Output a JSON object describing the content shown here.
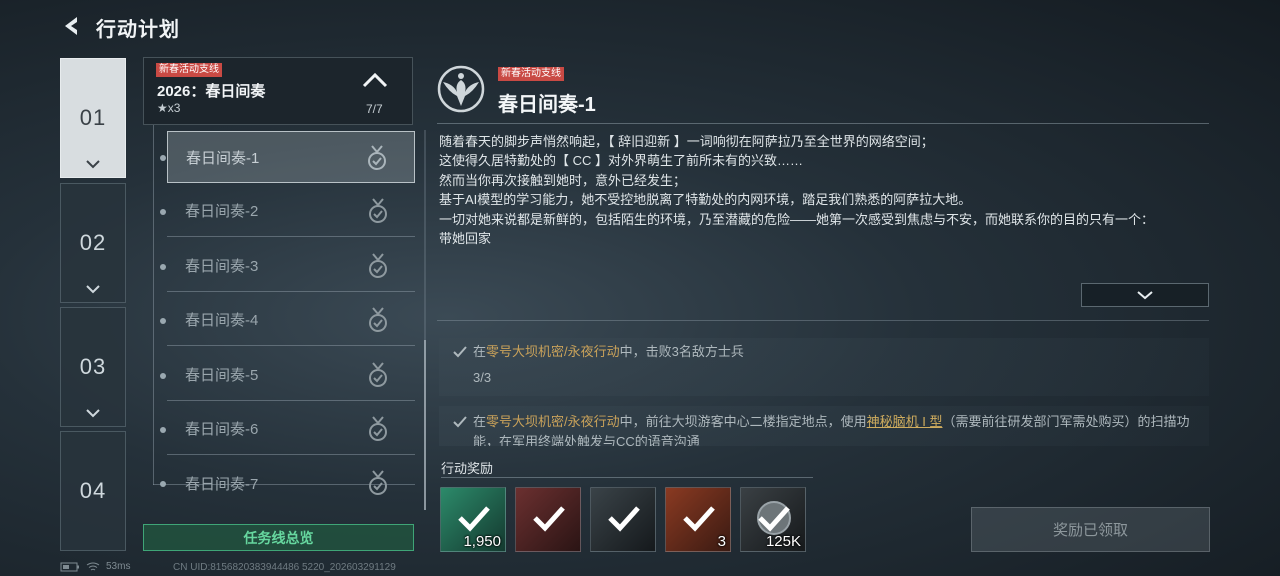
{
  "header": {
    "title": "行动计划"
  },
  "chapters": [
    {
      "num": "01",
      "active": true
    },
    {
      "num": "02",
      "active": false
    },
    {
      "num": "03",
      "active": false
    },
    {
      "num": "04",
      "active": false
    }
  ],
  "quest": {
    "tag": "新春活动支线",
    "title": "2026：春日间奏",
    "stars": "★x3",
    "progress": "7/7",
    "sub_items": [
      {
        "label": "春日间奏-1",
        "selected": true
      },
      {
        "label": "春日间奏-2",
        "selected": false
      },
      {
        "label": "春日间奏-3",
        "selected": false
      },
      {
        "label": "春日间奏-4",
        "selected": false
      },
      {
        "label": "春日间奏-5",
        "selected": false
      },
      {
        "label": "春日间奏-6",
        "selected": false
      },
      {
        "label": "春日间奏-7",
        "selected": false
      }
    ],
    "overview_button": "任务线总览"
  },
  "detail": {
    "tag": "新春活动支线",
    "title": "春日间奏-1",
    "story": [
      "随着春天的脚步声悄然响起，【 辞旧迎新 】一词响彻在阿萨拉乃至全世界的网络空间；",
      "这使得久居特勤处的【 CC 】对外界萌生了前所未有的兴致……",
      "然而当你再次接触到她时，意外已经发生；",
      "基于AI模型的学习能力，她不受控地脱离了特勤处的内网环境，踏足我们熟悉的阿萨拉大地。",
      "一切对她来说都是新鲜的，包括陌生的环境，乃至潜藏的危险——她第一次感受到焦虑与不安，而她联系你的目的只有一个：",
      "带她回家"
    ],
    "objectives": [
      {
        "prefix": "在",
        "location": "零号大坝机密/永夜行动",
        "middle": "中，击败3名敌方士兵",
        "progress": "3/3"
      },
      {
        "prefix": "在",
        "location": "零号大坝机密/永夜行动",
        "middle": "中，前往大坝游客中心二楼指定地点，使用",
        "item": "神秘脑机 I 型",
        "suffix": "（需要前往研发部门军需处购买）的扫描功能，在军用终端处触发与CC的语音沟通"
      }
    ],
    "rewards_label": "行动奖励",
    "rewards": [
      {
        "name": "green-badge-item",
        "qty": "1,950",
        "color": "#1f6e55"
      },
      {
        "name": "ammo-box-item",
        "qty": "",
        "color": "#5a2b2b"
      },
      {
        "name": "supply-case-item",
        "qty": "",
        "color": "#2a2f33"
      },
      {
        "name": "spring-scroll-item",
        "qty": "3",
        "color": "#6a2a1e"
      },
      {
        "name": "silver-coin-item",
        "qty": "125K",
        "color": "#2a2f33"
      }
    ],
    "claim_button": "奖励已领取"
  },
  "status": {
    "ping": "53ms",
    "uid": "CN UID:8156820383944486 5220_202603291129"
  },
  "colors": {
    "accent_green": "#3fa577",
    "tag_red": "#c94a44",
    "gold": "#c9a25a"
  }
}
